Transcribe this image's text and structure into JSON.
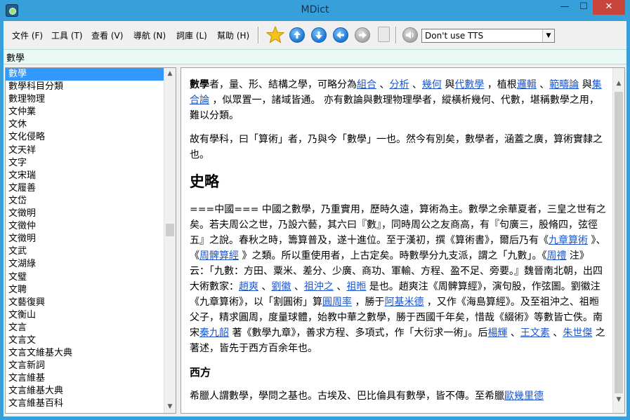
{
  "window": {
    "title": "MDict",
    "min_glyph": "—",
    "max_glyph": "☐",
    "close_glyph": "✕"
  },
  "menu": [
    "文件 (F)",
    "工具 (T)",
    "查看 (V)",
    "導航 (N)",
    "詞庫 (L)",
    "幫助 (H)"
  ],
  "toolbar": {
    "tts_value": "Don't use TTS"
  },
  "search": {
    "value": "數學"
  },
  "wordlist": [
    "數學",
    "數學科目分類",
    "數理物理",
    "文仲業",
    "文休",
    "文化侵略",
    "文天祥",
    "文字",
    "文宋瑞",
    "文履善",
    "文岱",
    "文徵明",
    "文徵仲",
    "文徵明",
    "文武",
    "文湖綠",
    "文璧",
    "文聘",
    "文藝復興",
    "文衡山",
    "文言",
    "文言文",
    "文言文維基大典",
    "文言新詞",
    "文言維基",
    "文言維基大典",
    "文言維基百科"
  ],
  "article": {
    "p1": [
      {
        "t": "數學",
        "b": true
      },
      {
        "t": "者，量、形、結構之學，可略分為"
      },
      {
        "t": "組合",
        "l": true
      },
      {
        "t": " 、"
      },
      {
        "t": "分析",
        "l": true
      },
      {
        "t": " 、"
      },
      {
        "t": "幾何",
        "l": true
      },
      {
        "t": " 與"
      },
      {
        "t": "代數學",
        "l": true
      },
      {
        "t": " ，植根"
      },
      {
        "t": "邏輯",
        "l": true
      },
      {
        "t": " 、"
      },
      {
        "t": "範疇論",
        "l": true
      },
      {
        "t": " 與"
      },
      {
        "t": "集合論",
        "l": true
      },
      {
        "t": " ，似眾置一，諸域皆通。 亦有數論與數理物理學者，縱橫析幾何、代數，堪稱數學之用，難以分類。"
      }
    ],
    "p2": [
      {
        "t": "故有學科，曰「算術」者，乃與今「數學」一也。然今有別矣，數學者，涵蓋之廣，算術實隸之也。"
      }
    ],
    "h2": "史略",
    "p3": [
      {
        "t": "===中國=== 中國之數學，乃重實用，歷時久遠，算術為主。數學之余華夏者，三皇之世有之矣。若夫周公之世，乃設六藝，其六曰『數』，同時周公之友商高，有『句廣三，股脩四，弦徑五』之說。春秋之時，籌算普及，遂十進位。至于漢初，撰《算術書》，爾后乃有《"
      },
      {
        "t": "九章算術",
        "l": true
      },
      {
        "t": " 》、《"
      },
      {
        "t": "周髀算經",
        "l": true
      },
      {
        "t": " 》之類。所以重使用者，上古定矣。時數學分九支派，謂之「九數」。《"
      },
      {
        "t": "周禮",
        "l": true
      },
      {
        "t": " 注》云：「九數：方田、粟米、差分、少廣、商功、軍輸、方程、盈不足、旁要。』魏晉南北朝，出四大術數家："
      },
      {
        "t": "趙爽",
        "l": true
      },
      {
        "t": " 、"
      },
      {
        "t": "劉徽",
        "l": true
      },
      {
        "t": " 、"
      },
      {
        "t": "祖沖之",
        "l": true
      },
      {
        "t": " 、"
      },
      {
        "t": "祖暅",
        "l": true
      },
      {
        "t": " 是也。趙爽注《周髀算經》，演句股，作弦圖。劉徽注《九章算術》，以「割圓術」算"
      },
      {
        "t": "圓周率",
        "l": true
      },
      {
        "t": " ，勝于"
      },
      {
        "t": "阿基米德",
        "l": true
      },
      {
        "t": " ，又作《海島算經》。及至祖沖之、祖暅父子，精求圓周，度量球體，始教中華之數學，勝于西國千年矣，惜哉《綴術》等數皆亡佚。南宋"
      },
      {
        "t": "秦九韶",
        "l": true
      },
      {
        "t": " 著《數學九章》，善求方程、多項式，作「大衍求一術」。后"
      },
      {
        "t": "楊輝",
        "l": true
      },
      {
        "t": " 、"
      },
      {
        "t": "王文素",
        "l": true
      },
      {
        "t": " 、"
      },
      {
        "t": "朱世傑",
        "l": true
      },
      {
        "t": " 之著述，皆先于西方百余年也。"
      }
    ],
    "h3": "西方",
    "p4": [
      {
        "t": "希臘人謂數學，學問之基也。古埃及、巴比倫具有數學，皆不傳。至希臘"
      },
      {
        "t": "歐幾里德",
        "l": true
      }
    ]
  }
}
